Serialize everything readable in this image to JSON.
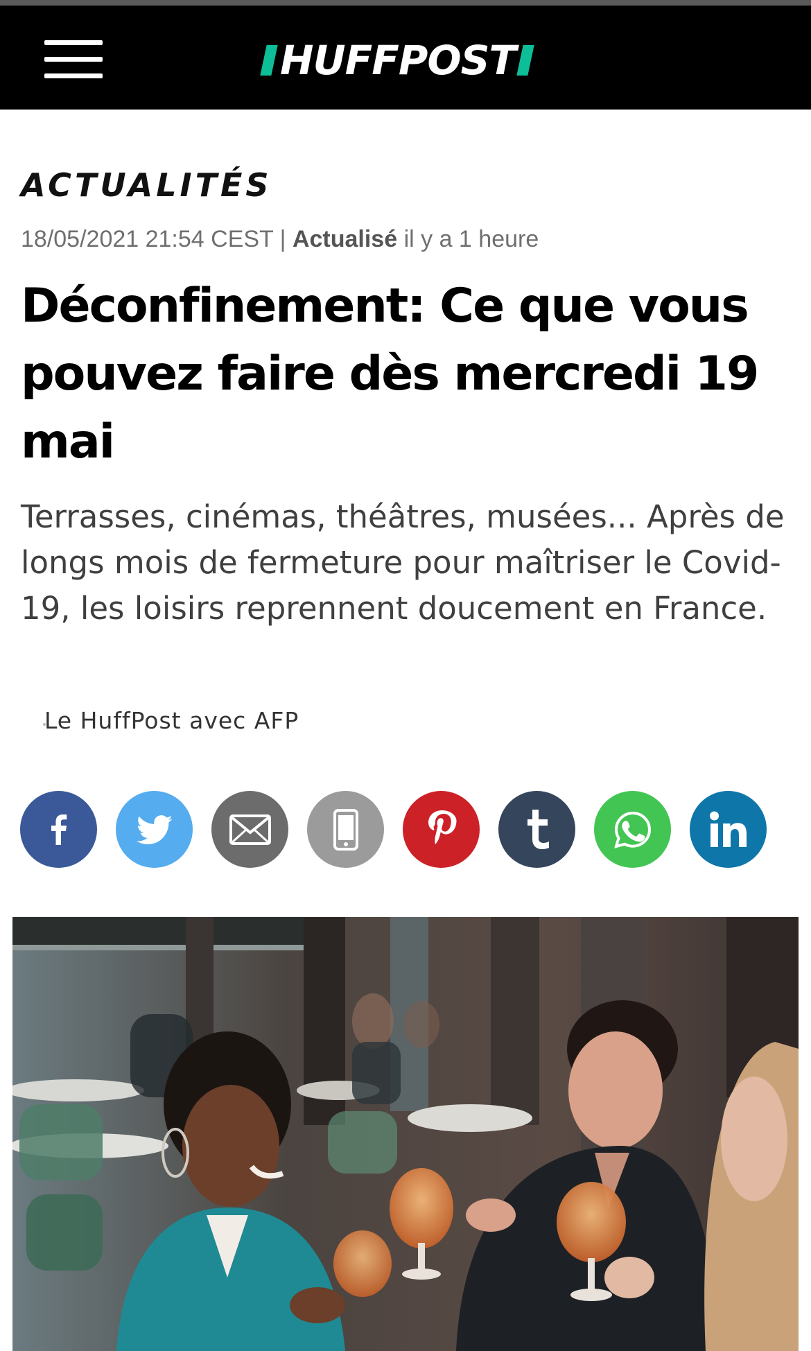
{
  "header": {
    "logo_text": "HUFFPOST",
    "accent_color": "#0dbe98",
    "menu_icon": "hamburger-menu-icon"
  },
  "article": {
    "section": "ACTUALITÉS",
    "published": "18/05/2021 21:54 CEST | ",
    "updated_label": "Actualisé",
    "updated_time": " il y a 1 heure",
    "headline": "Déconfinement: Ce que vous pouvez faire dès mercredi 19 mai",
    "dek": "Terrasses, cinémas, théâtres, musées... Après de longs mois de fermeture pour maîtriser le Covid-19, les loisirs reprennent doucement en France.",
    "author": "Le HuffPost avec AFP"
  },
  "share": [
    {
      "name": "facebook",
      "icon": "facebook-icon",
      "color": "#3b5998"
    },
    {
      "name": "twitter",
      "icon": "twitter-icon",
      "color": "#55acee"
    },
    {
      "name": "email",
      "icon": "mail-icon",
      "color": "#6c6c6c"
    },
    {
      "name": "sms",
      "icon": "phone-icon",
      "color": "#9b9b9b"
    },
    {
      "name": "pinterest",
      "icon": "pinterest-icon",
      "color": "#cc2127"
    },
    {
      "name": "tumblr",
      "icon": "tumblr-icon",
      "color": "#35465c"
    },
    {
      "name": "whatsapp",
      "icon": "whatsapp-icon",
      "color": "#43c553"
    },
    {
      "name": "linkedin",
      "icon": "linkedin-icon",
      "color": "#0e76a8"
    }
  ],
  "hero_image": {
    "subject": "terrace-cafe-friends-toasting-photo"
  }
}
